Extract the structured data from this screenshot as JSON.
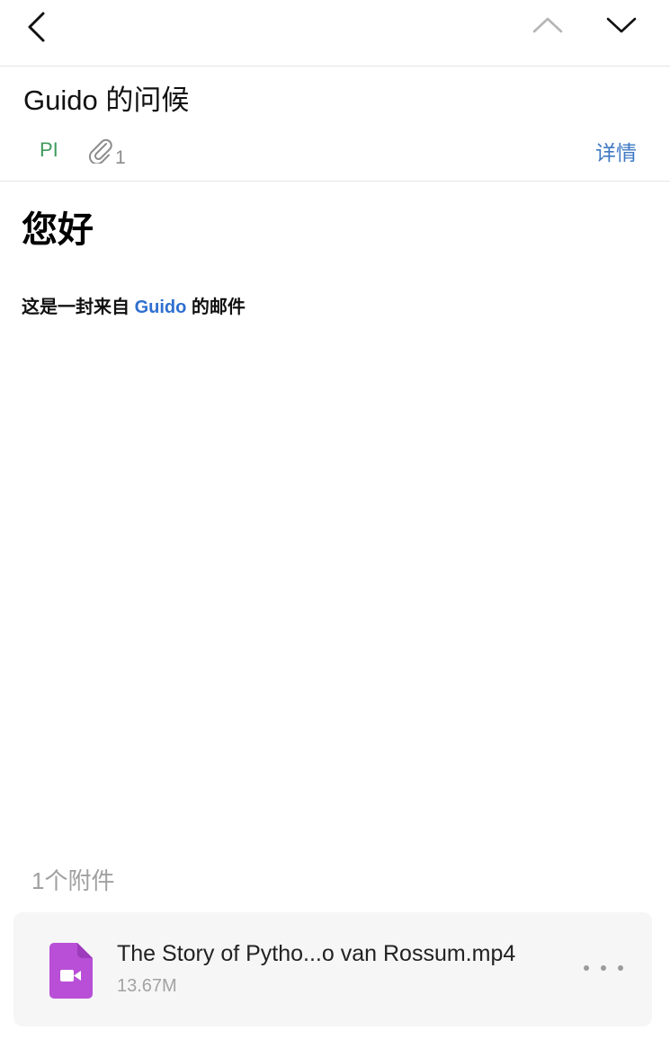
{
  "nav": {
    "back_icon": "chevron-left-icon",
    "prev_icon": "chevron-up-icon",
    "next_icon": "chevron-down-icon"
  },
  "email": {
    "subject": "Guido 的问候",
    "sender_tag": "PI",
    "attachment_indicator_icon": "paperclip-icon",
    "attachment_count": "1",
    "details_label": "详情",
    "greeting": "您好",
    "body_prefix": "这是一封来自",
    "body_link": "Guido",
    "body_suffix": "的邮件"
  },
  "attachments": {
    "label": "1个附件",
    "items": [
      {
        "icon": "video-file-icon",
        "name": "The Story of Pytho...o van Rossum.mp4",
        "size": "13.67M"
      }
    ]
  },
  "colors": {
    "tag_green": "#3f9a5c",
    "link_blue": "#2f6fd0",
    "details_blue": "#3f79c4",
    "file_icon_purple": "#b84fd6"
  }
}
